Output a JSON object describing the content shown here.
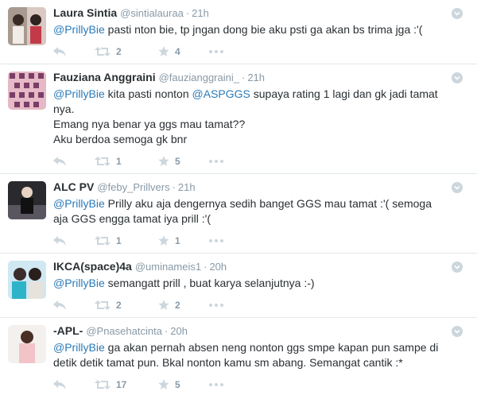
{
  "tweets": [
    {
      "name": "Laura Sintia",
      "handle": "@sintialauraa",
      "sep": "·",
      "time": "21h",
      "mention": "@PrillyBie",
      "text": " pasti nton bie, tp jngan dong bie aku psti ga akan bs trima jga :'(",
      "retweets": "2",
      "favorites": "4"
    },
    {
      "name": "Fauziana Anggraini",
      "handle": "@fauzianggraini_",
      "sep": "·",
      "time": "21h",
      "mention": "@PrillyBie",
      "text_mid": " kita pasti nonton ",
      "mention2": "@ASPGGS",
      "text": " supaya rating 1 lagi dan gk jadi tamat\nnya.\nEmang nya benar ya ggs mau tamat??\nAku berdoa semoga gk bnr",
      "retweets": "1",
      "favorites": "5"
    },
    {
      "name": "ALC PV",
      "handle": "@feby_Prillvers",
      "sep": "·",
      "time": "21h",
      "mention": "@PrillyBie",
      "text": " Prilly aku aja dengernya sedih banget GGS mau tamat :'( semoga\naja GGS engga tamat iya prill :'(",
      "retweets": "1",
      "favorites": "1"
    },
    {
      "name": "IKCA(space)4a",
      "handle": "@uminameis1",
      "sep": "·",
      "time": "20h",
      "mention": "@PrillyBie",
      "text": " semangatt prill , buat karya selanjutnya :-)",
      "retweets": "2",
      "favorites": "2"
    },
    {
      "name": "-APL-",
      "handle": "@Pnasehatcinta",
      "sep": "·",
      "time": "20h",
      "mention": "@PrillyBie",
      "text": " ga akan pernah absen neng nonton ggs smpe kapan pun sampe di\ndetik detik tamat pun. Bkal nonton kamu sm abang. Semangat cantik :*",
      "retweets": "17",
      "favorites": "5"
    }
  ],
  "icons": {
    "reply": "reply-icon",
    "retweet": "retweet-icon",
    "favorite": "star-icon",
    "more": "more-dots-icon",
    "caret": "chevron-down-icon"
  },
  "colors": {
    "mention": "#2b7bb9",
    "secondary": "#8899a6",
    "icon": "#ccd6dd",
    "divider": "#e1e8ed"
  }
}
